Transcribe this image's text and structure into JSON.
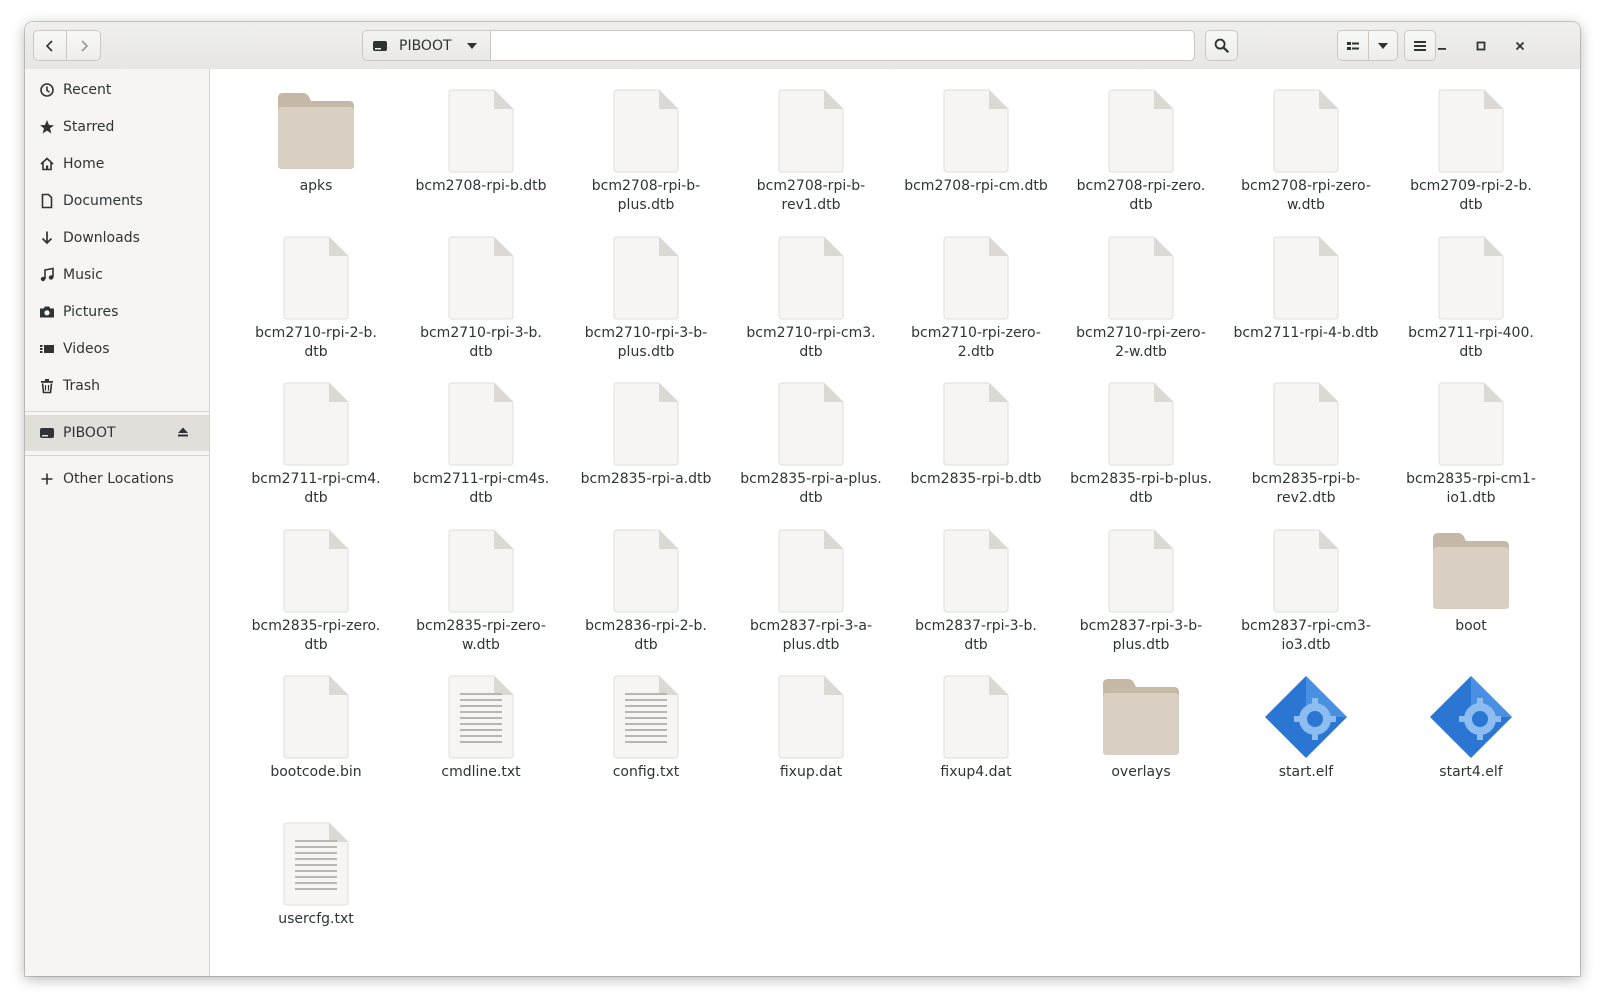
{
  "window": {
    "location": "PIBOOT"
  },
  "sidebar": {
    "items": [
      {
        "label": "Recent",
        "icon": "clock-icon"
      },
      {
        "label": "Starred",
        "icon": "star-icon"
      },
      {
        "label": "Home",
        "icon": "home-icon"
      },
      {
        "label": "Documents",
        "icon": "document-icon"
      },
      {
        "label": "Downloads",
        "icon": "download-icon"
      },
      {
        "label": "Music",
        "icon": "music-icon"
      },
      {
        "label": "Pictures",
        "icon": "camera-icon"
      },
      {
        "label": "Videos",
        "icon": "video-icon"
      },
      {
        "label": "Trash",
        "icon": "trash-icon"
      }
    ],
    "device": {
      "label": "PIBOOT",
      "icon": "drive-icon",
      "selected": true
    },
    "other": {
      "label": "Other Locations",
      "icon": "plus-icon"
    }
  },
  "files": [
    {
      "name": "apks",
      "type": "folder"
    },
    {
      "name": "bcm2708-rpi-b.dtb",
      "type": "file"
    },
    {
      "name": "bcm2708-rpi-b-plus.dtb",
      "type": "file",
      "lines": [
        "bcm2708-rpi-b-",
        "plus.dtb"
      ]
    },
    {
      "name": "bcm2708-rpi-b-rev1.dtb",
      "type": "file",
      "lines": [
        "bcm2708-rpi-b-",
        "rev1.dtb"
      ]
    },
    {
      "name": "bcm2708-rpi-cm.dtb",
      "type": "file"
    },
    {
      "name": "bcm2708-rpi-zero.dtb",
      "type": "file",
      "lines": [
        "bcm2708-rpi-zero.",
        "dtb"
      ]
    },
    {
      "name": "bcm2708-rpi-zero-w.dtb",
      "type": "file",
      "lines": [
        "bcm2708-rpi-zero-",
        "w.dtb"
      ]
    },
    {
      "name": "bcm2709-rpi-2-b.dtb",
      "type": "file",
      "lines": [
        "bcm2709-rpi-2-b.",
        "dtb"
      ]
    },
    {
      "name": "bcm2710-rpi-2-b.dtb",
      "type": "file",
      "lines": [
        "bcm2710-rpi-2-b.",
        "dtb"
      ]
    },
    {
      "name": "bcm2710-rpi-3-b.dtb",
      "type": "file",
      "lines": [
        "bcm2710-rpi-3-b.",
        "dtb"
      ]
    },
    {
      "name": "bcm2710-rpi-3-b-plus.dtb",
      "type": "file",
      "lines": [
        "bcm2710-rpi-3-b-",
        "plus.dtb"
      ]
    },
    {
      "name": "bcm2710-rpi-cm3.dtb",
      "type": "file",
      "lines": [
        "bcm2710-rpi-cm3.",
        "dtb"
      ]
    },
    {
      "name": "bcm2710-rpi-zero-2.dtb",
      "type": "file",
      "lines": [
        "bcm2710-rpi-zero-",
        "2.dtb"
      ]
    },
    {
      "name": "bcm2710-rpi-zero-2-w.dtb",
      "type": "file",
      "lines": [
        "bcm2710-rpi-zero-",
        "2-w.dtb"
      ]
    },
    {
      "name": "bcm2711-rpi-4-b.dtb",
      "type": "file"
    },
    {
      "name": "bcm2711-rpi-400.dtb",
      "type": "file",
      "lines": [
        "bcm2711-rpi-400.",
        "dtb"
      ]
    },
    {
      "name": "bcm2711-rpi-cm4.dtb",
      "type": "file",
      "lines": [
        "bcm2711-rpi-cm4.",
        "dtb"
      ]
    },
    {
      "name": "bcm2711-rpi-cm4s.dtb",
      "type": "file",
      "lines": [
        "bcm2711-rpi-cm4s.",
        "dtb"
      ]
    },
    {
      "name": "bcm2835-rpi-a.dtb",
      "type": "file"
    },
    {
      "name": "bcm2835-rpi-a-plus.dtb",
      "type": "file",
      "lines": [
        "bcm2835-rpi-a-plus.",
        "dtb"
      ]
    },
    {
      "name": "bcm2835-rpi-b.dtb",
      "type": "file"
    },
    {
      "name": "bcm2835-rpi-b-plus.dtb",
      "type": "file",
      "lines": [
        "bcm2835-rpi-b-plus.",
        "dtb"
      ]
    },
    {
      "name": "bcm2835-rpi-b-rev2.dtb",
      "type": "file",
      "lines": [
        "bcm2835-rpi-b-",
        "rev2.dtb"
      ]
    },
    {
      "name": "bcm2835-rpi-cm1-io1.dtb",
      "type": "file",
      "lines": [
        "bcm2835-rpi-cm1-",
        "io1.dtb"
      ]
    },
    {
      "name": "bcm2835-rpi-zero.dtb",
      "type": "file",
      "lines": [
        "bcm2835-rpi-zero.",
        "dtb"
      ]
    },
    {
      "name": "bcm2835-rpi-zero-w.dtb",
      "type": "file",
      "lines": [
        "bcm2835-rpi-zero-",
        "w.dtb"
      ]
    },
    {
      "name": "bcm2836-rpi-2-b.dtb",
      "type": "file",
      "lines": [
        "bcm2836-rpi-2-b.",
        "dtb"
      ]
    },
    {
      "name": "bcm2837-rpi-3-a-plus.dtb",
      "type": "file",
      "lines": [
        "bcm2837-rpi-3-a-",
        "plus.dtb"
      ]
    },
    {
      "name": "bcm2837-rpi-3-b.dtb",
      "type": "file",
      "lines": [
        "bcm2837-rpi-3-b.",
        "dtb"
      ]
    },
    {
      "name": "bcm2837-rpi-3-b-plus.dtb",
      "type": "file",
      "lines": [
        "bcm2837-rpi-3-b-",
        "plus.dtb"
      ]
    },
    {
      "name": "bcm2837-rpi-cm3-io3.dtb",
      "type": "file",
      "lines": [
        "bcm2837-rpi-cm3-",
        "io3.dtb"
      ]
    },
    {
      "name": "boot",
      "type": "folder"
    },
    {
      "name": "bootcode.bin",
      "type": "file"
    },
    {
      "name": "cmdline.txt",
      "type": "text"
    },
    {
      "name": "config.txt",
      "type": "text"
    },
    {
      "name": "fixup.dat",
      "type": "file"
    },
    {
      "name": "fixup4.dat",
      "type": "file"
    },
    {
      "name": "overlays",
      "type": "folder"
    },
    {
      "name": "start.elf",
      "type": "executable"
    },
    {
      "name": "start4.elf",
      "type": "executable"
    },
    {
      "name": "usercfg.txt",
      "type": "text"
    }
  ],
  "colors": {
    "folder": "#d9cfc3",
    "file": "#f6f5f4",
    "executable": "#2a76d2"
  }
}
